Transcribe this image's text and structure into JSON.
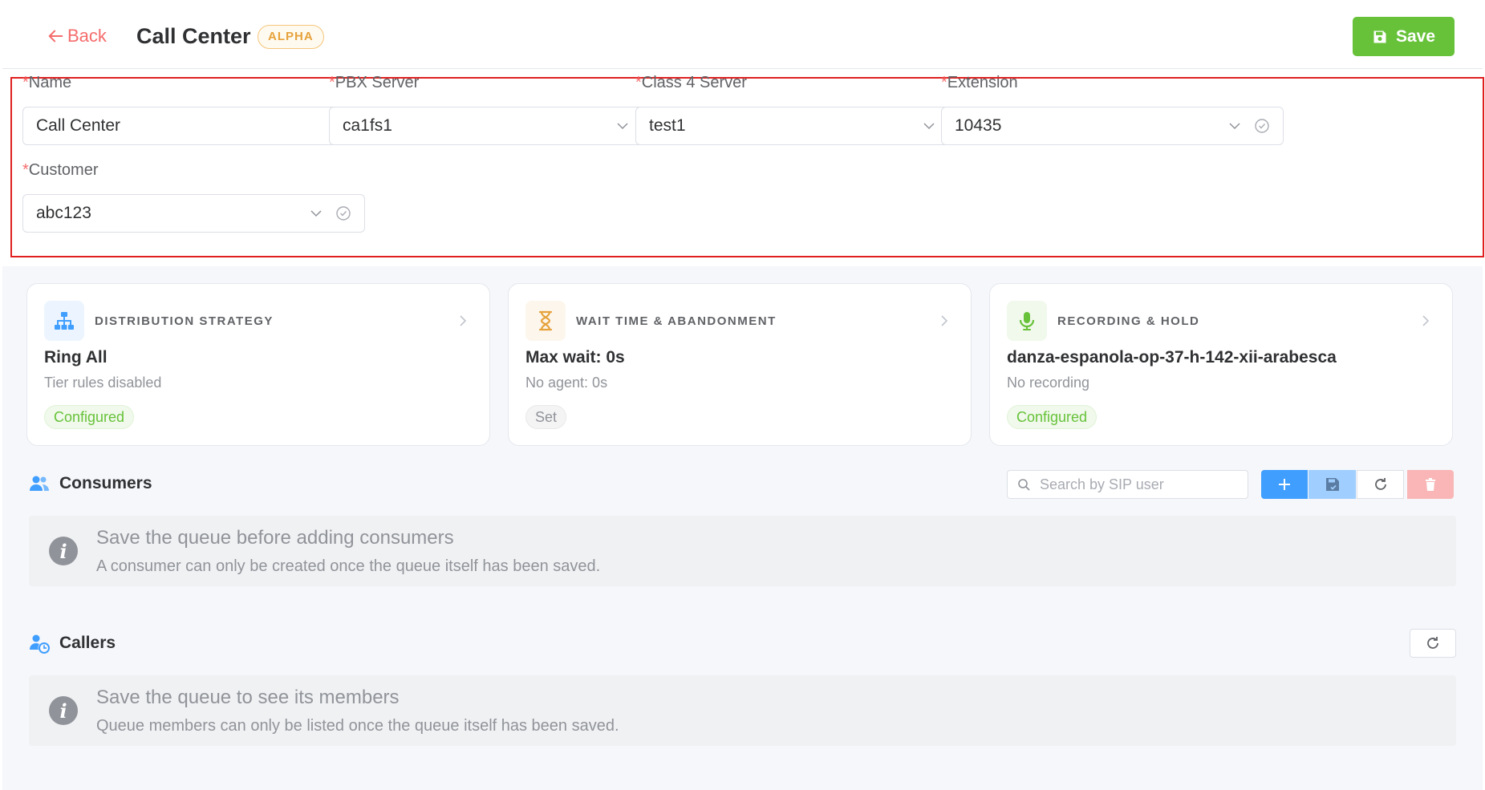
{
  "header": {
    "back_label": "Back",
    "title": "Call Center",
    "badge": "ALPHA",
    "save_label": "Save"
  },
  "form": {
    "name": {
      "label": "Name",
      "required": "*",
      "value": "Call Center"
    },
    "pbx_server": {
      "label": "PBX Server",
      "required": "*",
      "value": "ca1fs1"
    },
    "class4_server": {
      "label": "Class 4 Server",
      "required": "*",
      "value": "test1"
    },
    "extension": {
      "label": "Extension",
      "required": "*",
      "value": "10435"
    },
    "customer": {
      "label": "Customer",
      "required": "*",
      "value": "abc123"
    }
  },
  "cards": [
    {
      "title": "DISTRIBUTION STRATEGY",
      "value": "Ring All",
      "sub": "Tier rules disabled",
      "tag": "Configured",
      "icon": "sitemap-icon"
    },
    {
      "title": "WAIT TIME & ABANDONMENT",
      "value": "Max wait: 0s",
      "sub": "No agent: 0s",
      "tag": "Set",
      "icon": "hourglass-icon"
    },
    {
      "title": "RECORDING & HOLD",
      "value": "danza-espanola-op-37-h-142-xii-arabesca",
      "sub": "No recording",
      "tag": "Configured",
      "icon": "microphone-icon"
    }
  ],
  "consumers": {
    "title": "Consumers",
    "search_placeholder": "Search by SIP user",
    "notice_title": "Save the queue before adding consumers",
    "notice_desc": "A consumer can only be created once the queue itself has been saved."
  },
  "callers": {
    "title": "Callers",
    "notice_title": "Save the queue to see its members",
    "notice_desc": "Queue members can only be listed once the queue itself has been saved."
  },
  "colors": {
    "primary": "#409eff",
    "success": "#67c23a",
    "warning": "#e6a23c",
    "danger": "#f56c6c",
    "highlight_border": "#e02020"
  }
}
